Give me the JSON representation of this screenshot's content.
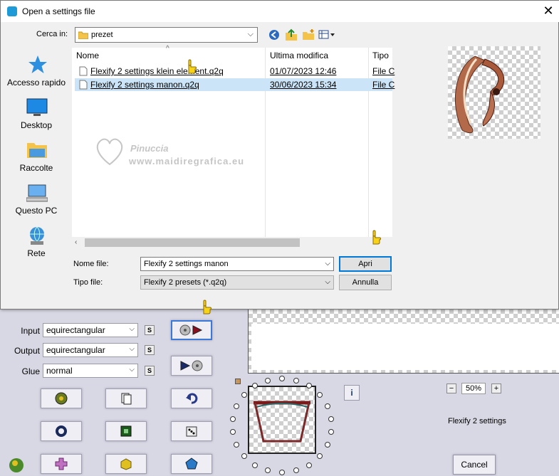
{
  "dialog": {
    "title": "Open a settings file",
    "close_glyph": "✕",
    "look_in_label": "Cerca in:",
    "look_in_value": "prezet",
    "places": [
      {
        "label": "Accesso rapido",
        "icon": "star-icon"
      },
      {
        "label": "Desktop",
        "icon": "desktop-icon"
      },
      {
        "label": "Raccolte",
        "icon": "libraries-icon"
      },
      {
        "label": "Questo PC",
        "icon": "computer-icon"
      },
      {
        "label": "Rete",
        "icon": "network-icon"
      }
    ],
    "columns": {
      "name": "Nome",
      "modified": "Ultima modifica",
      "type": "Tipo"
    },
    "files": [
      {
        "name": "Flexify 2 settings klein element.q2q",
        "modified": "01/07/2023 12:46",
        "type": "File C"
      },
      {
        "name": "Flexify 2 settings manon.q2q",
        "modified": "30/06/2023 15:34",
        "type": "File C"
      }
    ],
    "filename_label": "Nome file:",
    "filename_value": "Flexify 2 settings manon",
    "filetype_label": "Tipo file:",
    "filetype_value": "Flexify 2 presets (*.q2q)",
    "open_button": "Apri",
    "cancel_button": "Annulla"
  },
  "watermark": {
    "line1": "Pinuccia",
    "line2": "www.maidiregrafica.eu"
  },
  "plugin": {
    "input_label": "Input",
    "input_value": "equirectangular",
    "output_label": "Output",
    "output_value": "equirectangular",
    "glue_label": "Glue",
    "glue_value": "normal",
    "s_glyph": "S",
    "zoom_minus": "−",
    "zoom_value": "50%",
    "zoom_plus": "+",
    "info_glyph": "i",
    "settings_name": "Flexify 2 settings",
    "cancel_button": "Cancel"
  }
}
